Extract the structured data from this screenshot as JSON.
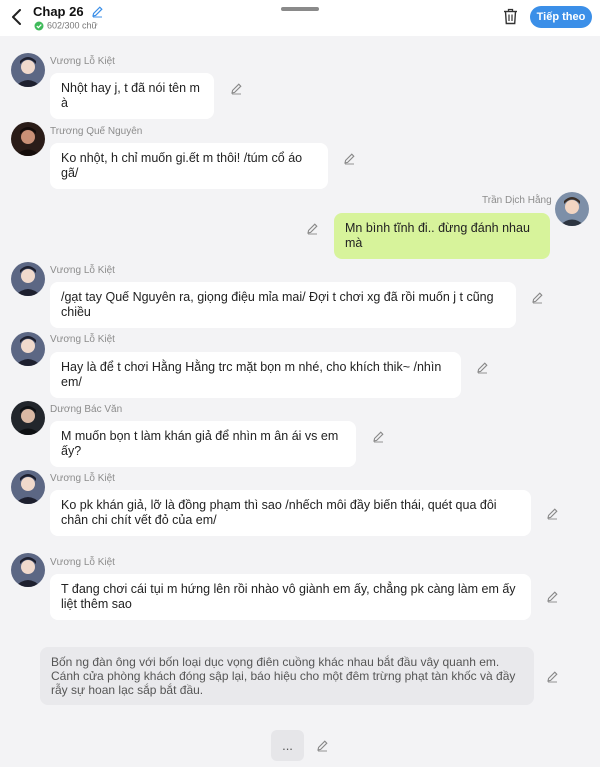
{
  "header": {
    "title": "Chap 26",
    "word_count": "602/300 chữ",
    "next_label": "Tiếp theo",
    "accent": "#3b8fe8"
  },
  "messages": [
    {
      "sender": "Vương Lỗ Kiệt",
      "text": "Nhột hay j, t đã nói tên m à",
      "side": "left"
    },
    {
      "sender": "Trương Quế Nguyên",
      "text": "Ko nhột, h chỉ muốn gi.ết m thôi! /túm cổ áo gã/",
      "side": "left"
    },
    {
      "sender": "Trần Dịch Hằng",
      "text": "Mn bình tĩnh đi.. đừng đánh nhau mà",
      "side": "right"
    },
    {
      "sender": "Vương Lỗ Kiệt",
      "text": "/gạt tay Quế Nguyên ra, giọng điệu mỉa mai/ Đợi t chơi xg đã rồi muốn j t cũng chiều",
      "side": "left"
    },
    {
      "sender": "Vương Lỗ Kiệt",
      "text": "Hay là để t chơi Hằng Hằng trc mặt bọn m nhé, cho khích thik~ /nhìn em/",
      "side": "left"
    },
    {
      "sender": "Dương Bác Văn",
      "text": "M muốn bọn t làm khán giả để nhìn m ân ái vs em ấy?",
      "side": "left"
    },
    {
      "sender": "Vương Lỗ Kiệt",
      "text": "Ko pk khán giả, lỡ là đồng phạm thì sao /nhếch môi đầy biến thái, quét qua đôi chân chi chít vết đỏ của em/",
      "side": "left"
    },
    {
      "sender": "Vương Lỗ Kiệt",
      "text": "T đang chơi cái tụi m hứng lên rồi nhào vô giành em ấy, chẳng pk càng làm em ấy liệt thêm sao",
      "side": "left"
    }
  ],
  "narration": "Bốn ng đàn ông với bốn loại dục vọng điên cuồng khác nhau bắt đầu vây quanh em. Cánh cửa phòng khách đóng sập lại, báo hiệu cho một đêm trừng phạt tàn khốc và đầy rẫy sự hoan lạc sắp bắt đầu.",
  "typing_placeholder": "...",
  "colors": {
    "my_bubble": "#d7f39b",
    "other_bubble": "#ffffff",
    "narration_bubble": "#e9e9ec",
    "background": "#f3f3f5"
  },
  "icons": [
    "back-arrow-icon",
    "pencil-icon",
    "check-circle-icon",
    "trash-icon",
    "avatar"
  ]
}
